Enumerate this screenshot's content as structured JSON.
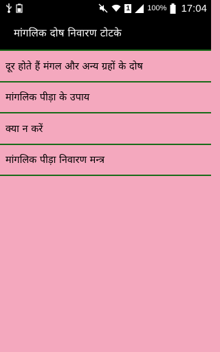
{
  "status_bar": {
    "icons": [
      "usb-icon",
      "battery-status-icon",
      "silent-mode-icon",
      "wifi-icon",
      "sim-badge",
      "signal-icon",
      "battery-icon"
    ],
    "sim_label": "1",
    "battery_percent": "100%",
    "time": "17:04"
  },
  "app": {
    "title": "मांगलिक दोष निवारण टोटके"
  },
  "list": {
    "items": [
      {
        "label": "दूर होते हैं मंगल और अन्य ग्रहों के दोष"
      },
      {
        "label": "मांगलिक पीड़ा के उपाय"
      },
      {
        "label": "क्या न करें"
      },
      {
        "label": "मांगलिक पीड़ा निवारण मन्त्र"
      }
    ]
  },
  "colors": {
    "background": "#f4a8be",
    "divider": "#1a6b1a",
    "bar": "#000000"
  }
}
